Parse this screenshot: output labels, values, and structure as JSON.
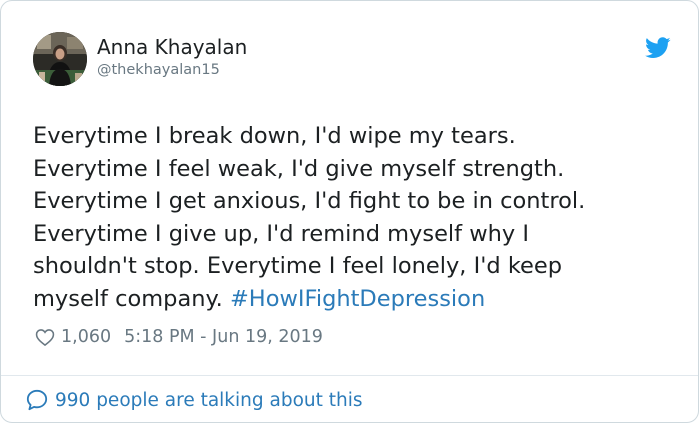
{
  "user": {
    "display_name": "Anna Khayalan",
    "handle": "@thekhayalan15",
    "avatar_icon": "profile-photo"
  },
  "brand": {
    "icon": "twitter-bird-icon",
    "color": "#1da1f2"
  },
  "tweet": {
    "lines": [
      "Everytime I break down, I'd wipe my tears.",
      "Everytime I feel weak, I'd give myself strength.",
      "Everytime I get anxious, I'd fight to be in control.",
      "Everytime I give up, I'd remind myself why I",
      "shouldn't stop. Everytime I feel lonely, I'd keep"
    ],
    "last_line_text": "myself company.",
    "hashtag": "#HowIFightDepression",
    "text_color": "#1c2022",
    "link_color": "#2b7bb9"
  },
  "meta": {
    "like_icon": "heart-outline-icon",
    "likes": "1,060",
    "timestamp": "5:18 PM - Jun 19, 2019",
    "meta_color": "#697882"
  },
  "footer": {
    "icon": "speech-bubble-icon",
    "talking_text": "990 people are talking about this"
  }
}
